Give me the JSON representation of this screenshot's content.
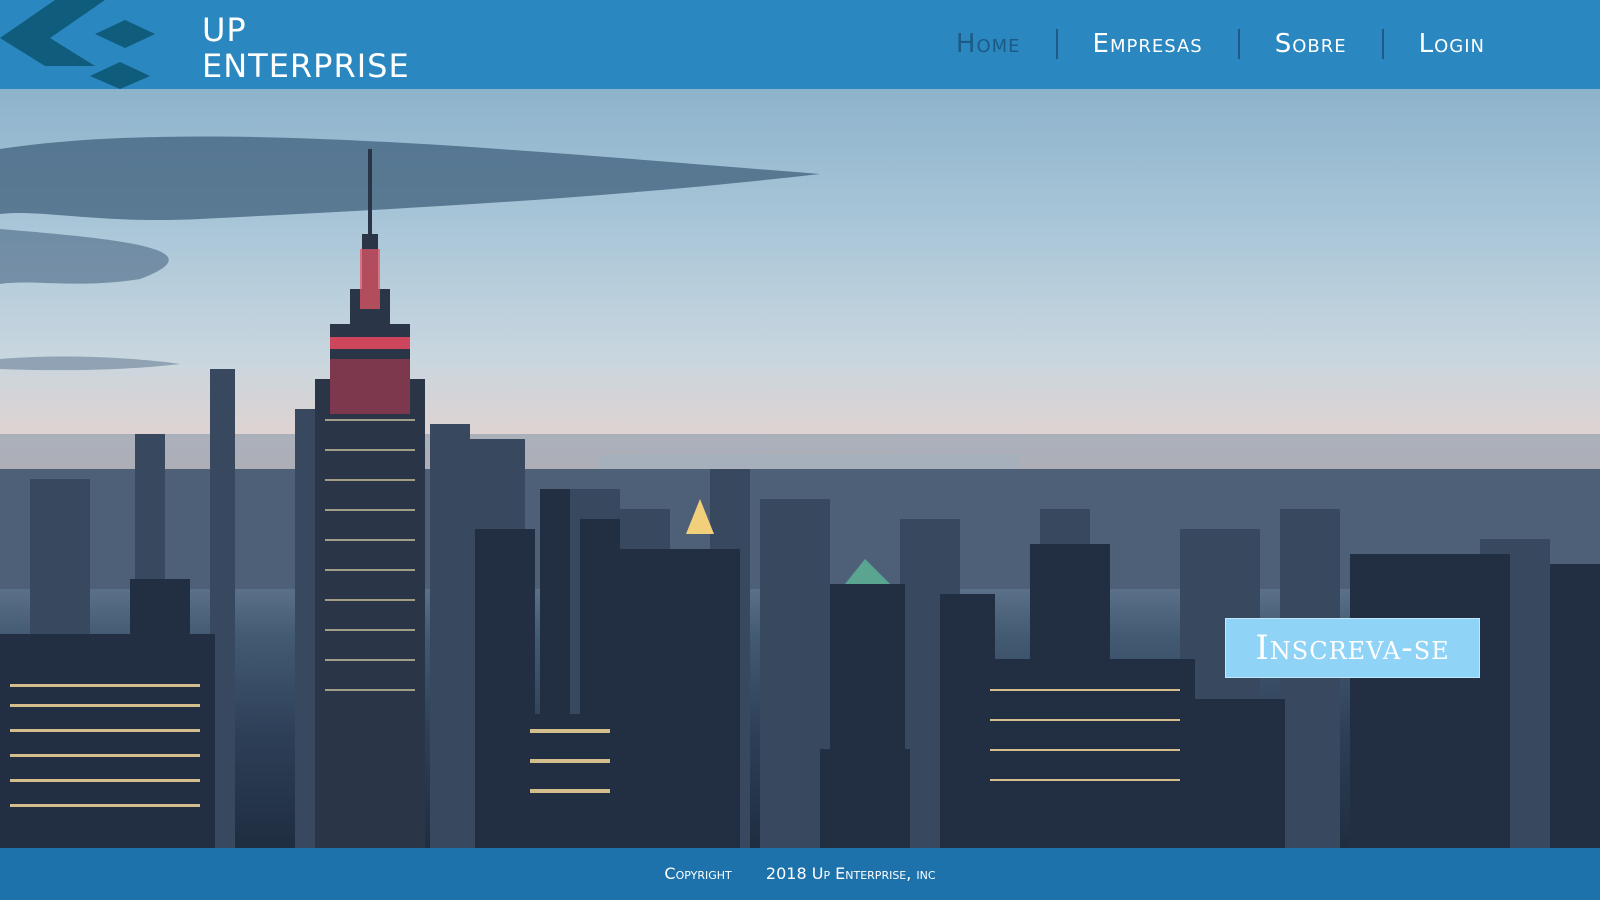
{
  "header": {
    "brand_line1": "UP",
    "brand_line2": "ENTERPRISE",
    "logo_icon": "diamond-chevron-logo",
    "nav": [
      {
        "label": "Home",
        "active": true
      },
      {
        "label": "Empresas",
        "active": false
      },
      {
        "label": "Sobre",
        "active": false
      },
      {
        "label": "Login",
        "active": false
      }
    ]
  },
  "hero": {
    "cta_label": "Inscreva-se"
  },
  "footer": {
    "copyright_label": "Copyright",
    "copyright_text": "2018 Up Enterprise, inc"
  },
  "colors": {
    "header_bg": "#2a87c0",
    "nav_active": "#1d5b86",
    "cta_bg": "#8fd3f7",
    "footer_bg": "#1e78b4"
  }
}
